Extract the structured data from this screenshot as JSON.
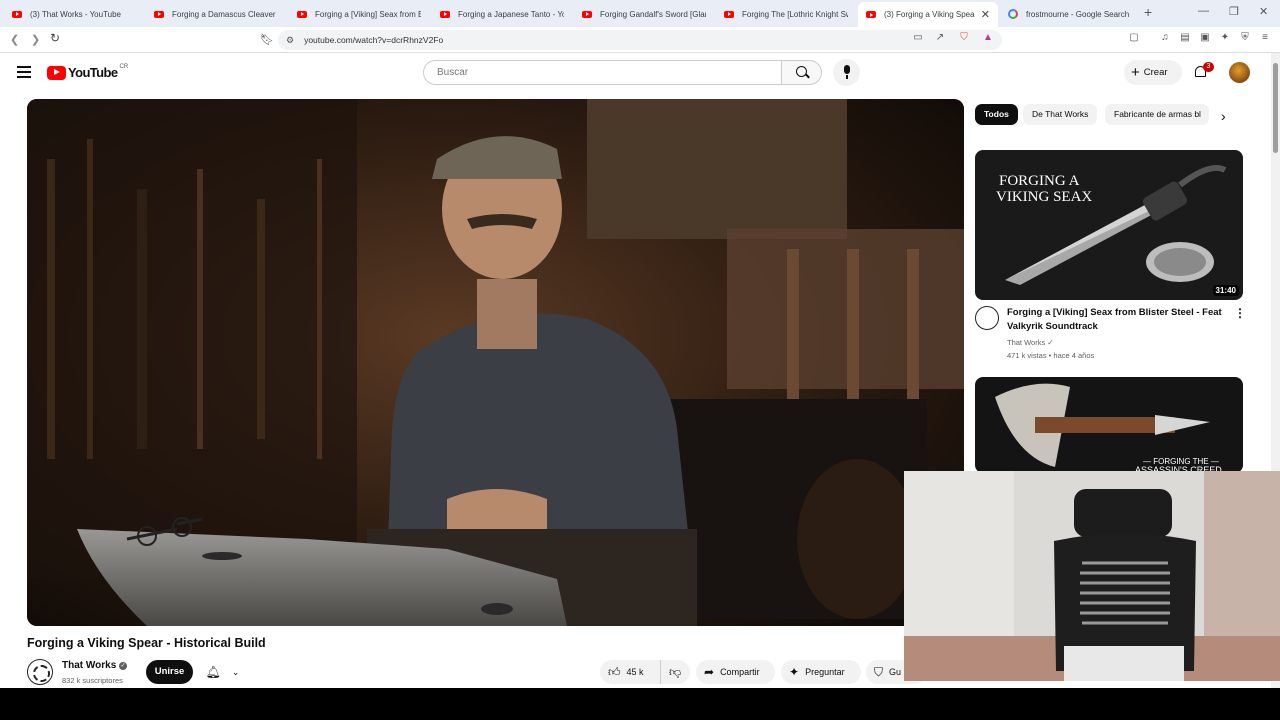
{
  "browser": {
    "tabs": [
      {
        "label": "(3) That Works - YouTube",
        "icon": "youtube-icon",
        "active": false
      },
      {
        "label": "Forging a Damascus Cleaver -",
        "icon": "youtube-icon",
        "active": false
      },
      {
        "label": "Forging a [Viking] Seax from B",
        "icon": "youtube-icon",
        "active": false
      },
      {
        "label": "Forging a Japanese Tanto - You",
        "icon": "youtube-icon",
        "active": false
      },
      {
        "label": "Forging Gandalf's Sword [Glam",
        "icon": "youtube-icon",
        "active": false
      },
      {
        "label": "Forging The [Lothric Knight Sw",
        "icon": "youtube-icon",
        "active": false
      },
      {
        "label": "(3) Forging a Viking Spear",
        "icon": "youtube-icon",
        "active": true
      },
      {
        "label": "frostmourne - Google Search",
        "icon": "google-icon",
        "active": false
      }
    ],
    "url": "youtube.com/watch?v=dcrRhnzV2Fo"
  },
  "header": {
    "logo_text": "YouTube",
    "country_code": "CR",
    "search_placeholder": "Buscar",
    "create_label": "Crear",
    "notification_count": "3"
  },
  "video": {
    "title": "Forging a Viking Spear - Historical Build",
    "channel": "That Works",
    "subscribers": "832 k suscriptores",
    "join_label": "Unirse",
    "likes": "45 k",
    "share_label": "Compartir",
    "ask_label": "Preguntar",
    "save_label": "Gu"
  },
  "chips": [
    "Todos",
    "De That Works",
    "Fabricante de armas bl"
  ],
  "recommendations": [
    {
      "title": "Forging a [Viking] Seax from Blister Steel - Feat Valkyrik Soundtrack",
      "channel": "That Works",
      "meta": "471 k vistas • hace 4 años",
      "duration": "31:40",
      "thumb_text_1": "FORGING A",
      "thumb_text_2": "VIKING SEAX"
    },
    {
      "thumb_text_1": "— FORGING THE —",
      "thumb_text_2": "ASSASSIN'S CREED"
    }
  ],
  "colors": {
    "brand": "#ff0000",
    "chip_active": "#0f0f0f"
  }
}
